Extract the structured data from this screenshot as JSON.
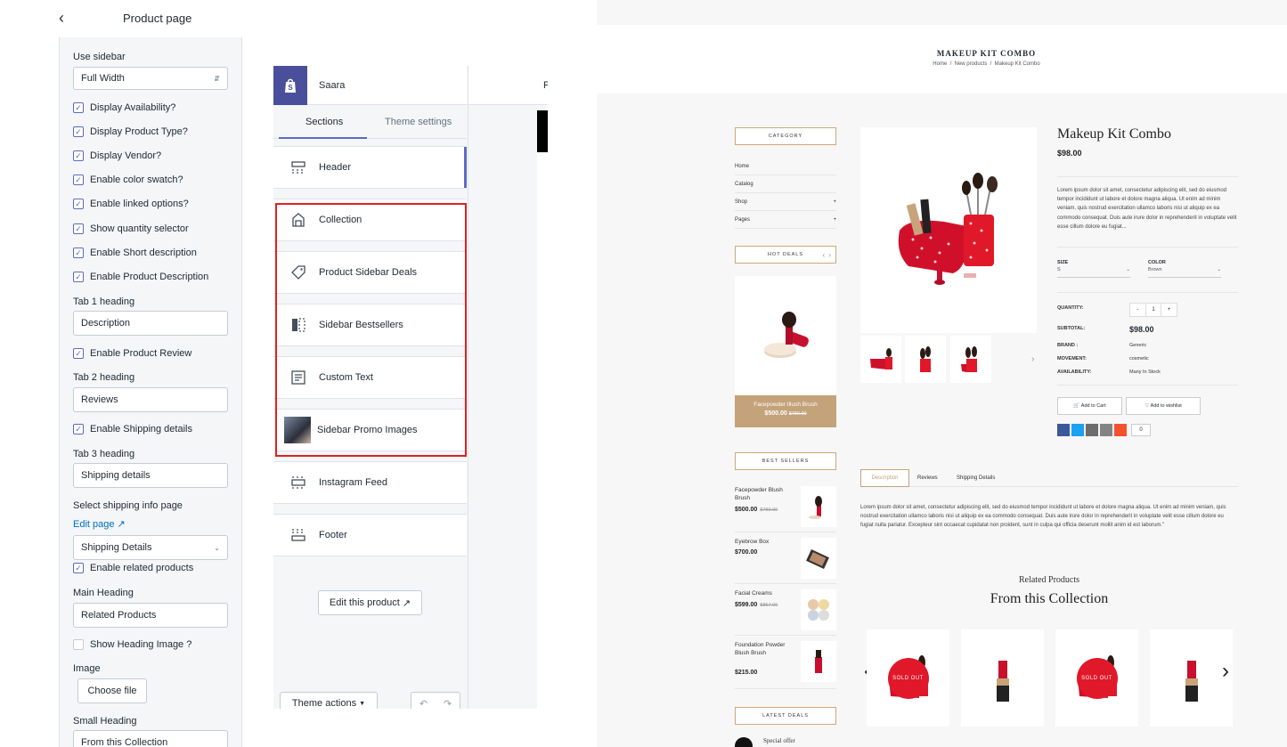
{
  "editor": {
    "back_icon": "chevron-left-icon",
    "title": "Product page",
    "use_sidebar_label": "Use sidebar",
    "use_sidebar_value": "Full Width",
    "checks": [
      {
        "label": "Display Availability?",
        "checked": true
      },
      {
        "label": "Display Product Type?",
        "checked": true
      },
      {
        "label": "Display Vendor?",
        "checked": true
      },
      {
        "label": "Enable color swatch?",
        "checked": true
      },
      {
        "label": "Enable linked options?",
        "checked": true
      },
      {
        "label": "Show quantity selector",
        "checked": true
      },
      {
        "label": "Enable Short description",
        "checked": true
      },
      {
        "label": "Enable Product Description",
        "checked": true
      }
    ],
    "tab1_heading_label": "Tab 1 heading",
    "tab1_heading_value": "Description",
    "enable_review_label": "Enable Product Review",
    "tab2_heading_label": "Tab 2 heading",
    "tab2_heading_value": "Reviews",
    "enable_shipping_label": "Enable Shipping details",
    "tab3_heading_label": "Tab 3 heading",
    "tab3_heading_value": "Shipping details",
    "shipping_page_label": "Select shipping info page",
    "edit_page_link": "Edit page",
    "shipping_page_value": "Shipping Details",
    "enable_related_label": "Enable related products",
    "main_heading_label": "Main Heading",
    "main_heading_value": "Related Products",
    "show_heading_image_label": "Show Heading Image ?",
    "image_label": "Image",
    "choose_file": "Choose file",
    "small_heading_label": "Small Heading",
    "small_heading_value": "From this Collection"
  },
  "sections_panel": {
    "store_name": "Saara",
    "tabs": [
      "Sections",
      "Theme settings"
    ],
    "sections": [
      {
        "label": "Header",
        "icon": "header-icon"
      },
      {
        "label": "Collection",
        "icon": "collection-icon"
      },
      {
        "label": "Product Sidebar Deals",
        "icon": "tag-icon"
      },
      {
        "label": "Sidebar Bestsellers",
        "icon": "sidebar-icon"
      },
      {
        "label": "Custom Text",
        "icon": "text-icon"
      },
      {
        "label": "Sidebar Promo Images",
        "icon": "image-thumbnail-icon"
      },
      {
        "label": "Instagram Feed",
        "icon": "instagram-icon"
      },
      {
        "label": "Footer",
        "icon": "footer-icon"
      }
    ],
    "edit_product": "Edit this product",
    "theme_actions": "Theme actions",
    "preview_letter": "P"
  },
  "store": {
    "page_title": "MAKEUP KIT COMBO",
    "breadcrumb": [
      "Home",
      "New products",
      "Makeup Kit Combo"
    ],
    "category_title": "CATEGORY",
    "categories": [
      {
        "label": "Home",
        "plus": ""
      },
      {
        "label": "Catalog",
        "plus": ""
      },
      {
        "label": "Shop",
        "plus": "+"
      },
      {
        "label": "Pages",
        "plus": "+"
      }
    ],
    "hot_deals_title": "HOT DEALS",
    "hot_deal": {
      "name": "Facepowder Illush Brush",
      "price": "$500.00",
      "old": "$780.00"
    },
    "best_sellers_title": "BEST SELLERS",
    "best_sellers": [
      {
        "name": "Facepowder Blush Brush",
        "price": "$500.00",
        "old": "$780.00"
      },
      {
        "name": "Eyebrow Box",
        "price": "$700.00",
        "old": ""
      },
      {
        "name": "Facial Creams",
        "price": "$599.00",
        "old": "$857.00"
      },
      {
        "name": "Foundation Powder Blush Brush",
        "price": "$215.00",
        "old": ""
      }
    ],
    "latest_deals_title": "LATEST DEALS",
    "special_offer": "Special offer",
    "product": {
      "name": "Makeup Kit Combo",
      "price": "$98.00",
      "short_desc": "Lorem ipsum dolor sit amet, consectetur adipiscing elit, sed do eiusmod tempor incididunt ut labore et dolore magna aliqua. Ut enim ad minim veniam, quis nostrud exercitation ullamco laboris nisi ut aliquip ex ea commodo consequat. Duis aute irure dolor in reprehenderit in voluptate velit esse cillum dolore eu fugiat...",
      "size_label": "SIZE",
      "size_value": "S",
      "color_label": "COLOR",
      "color_value": "Brown",
      "quantity_label": "QUANTITY:",
      "quantity_value": "1",
      "minus": "-",
      "plus": "+",
      "subtotal_label": "SUBTOTAL:",
      "subtotal_value": "$98.00",
      "brand_label": "BRAND :",
      "brand_value": "Generic",
      "movement_label": "MOVEMENT:",
      "movement_value": "cosmetic",
      "availability_label": "AVAILABILITY:",
      "availability_value": "Many In Stock",
      "add_to_cart": "Add to Cart",
      "add_to_wishlist": "Add to wishlist",
      "share_count": "0"
    },
    "tabs": [
      "Description",
      "Reviews",
      "Shipping Details"
    ],
    "description": "Lorem ipsum dolor sit amet, consectetur adipiscing elit, sed do eiusmod tempor incididunt ut labore et dolore magna aliqua. Ut enim ad minim veniam, quis nostrud exercitation ullamco laboris nisi ut aliquip ex ea commodo consequat. Duis aute irure dolor in reprehenderit in voluptate velit esse cillum dolore eu fugiat nulla pariatur. Excepteur sint occaecat cupidatat non proident, sunt in culpa qui officia deserunt mollit anim id est laborum.\"",
    "related_small": "Related Products",
    "related_big": "From this Collection",
    "sold_out": "SOLD OUT",
    "colors": {
      "gold": "#c4a27a",
      "red": "#e0182a",
      "accent": "#5c6ac4"
    }
  }
}
